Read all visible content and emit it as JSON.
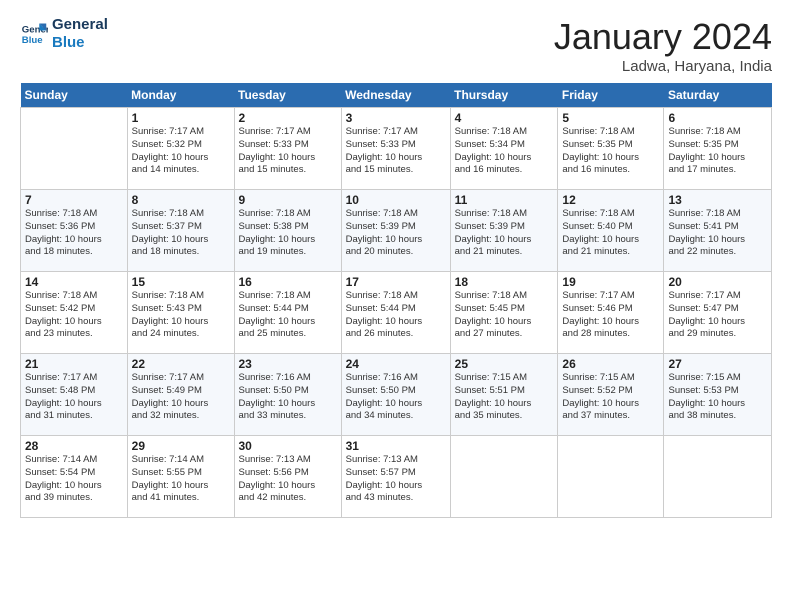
{
  "header": {
    "logo_line1": "General",
    "logo_line2": "Blue",
    "title": "January 2024",
    "location": "Ladwa, Haryana, India"
  },
  "columns": [
    "Sunday",
    "Monday",
    "Tuesday",
    "Wednesday",
    "Thursday",
    "Friday",
    "Saturday"
  ],
  "weeks": [
    [
      {
        "day": "",
        "info": ""
      },
      {
        "day": "1",
        "info": "Sunrise: 7:17 AM\nSunset: 5:32 PM\nDaylight: 10 hours\nand 14 minutes."
      },
      {
        "day": "2",
        "info": "Sunrise: 7:17 AM\nSunset: 5:33 PM\nDaylight: 10 hours\nand 15 minutes."
      },
      {
        "day": "3",
        "info": "Sunrise: 7:17 AM\nSunset: 5:33 PM\nDaylight: 10 hours\nand 15 minutes."
      },
      {
        "day": "4",
        "info": "Sunrise: 7:18 AM\nSunset: 5:34 PM\nDaylight: 10 hours\nand 16 minutes."
      },
      {
        "day": "5",
        "info": "Sunrise: 7:18 AM\nSunset: 5:35 PM\nDaylight: 10 hours\nand 16 minutes."
      },
      {
        "day": "6",
        "info": "Sunrise: 7:18 AM\nSunset: 5:35 PM\nDaylight: 10 hours\nand 17 minutes."
      }
    ],
    [
      {
        "day": "7",
        "info": "Sunrise: 7:18 AM\nSunset: 5:36 PM\nDaylight: 10 hours\nand 18 minutes."
      },
      {
        "day": "8",
        "info": "Sunrise: 7:18 AM\nSunset: 5:37 PM\nDaylight: 10 hours\nand 18 minutes."
      },
      {
        "day": "9",
        "info": "Sunrise: 7:18 AM\nSunset: 5:38 PM\nDaylight: 10 hours\nand 19 minutes."
      },
      {
        "day": "10",
        "info": "Sunrise: 7:18 AM\nSunset: 5:39 PM\nDaylight: 10 hours\nand 20 minutes."
      },
      {
        "day": "11",
        "info": "Sunrise: 7:18 AM\nSunset: 5:39 PM\nDaylight: 10 hours\nand 21 minutes."
      },
      {
        "day": "12",
        "info": "Sunrise: 7:18 AM\nSunset: 5:40 PM\nDaylight: 10 hours\nand 21 minutes."
      },
      {
        "day": "13",
        "info": "Sunrise: 7:18 AM\nSunset: 5:41 PM\nDaylight: 10 hours\nand 22 minutes."
      }
    ],
    [
      {
        "day": "14",
        "info": "Sunrise: 7:18 AM\nSunset: 5:42 PM\nDaylight: 10 hours\nand 23 minutes."
      },
      {
        "day": "15",
        "info": "Sunrise: 7:18 AM\nSunset: 5:43 PM\nDaylight: 10 hours\nand 24 minutes."
      },
      {
        "day": "16",
        "info": "Sunrise: 7:18 AM\nSunset: 5:44 PM\nDaylight: 10 hours\nand 25 minutes."
      },
      {
        "day": "17",
        "info": "Sunrise: 7:18 AM\nSunset: 5:44 PM\nDaylight: 10 hours\nand 26 minutes."
      },
      {
        "day": "18",
        "info": "Sunrise: 7:18 AM\nSunset: 5:45 PM\nDaylight: 10 hours\nand 27 minutes."
      },
      {
        "day": "19",
        "info": "Sunrise: 7:17 AM\nSunset: 5:46 PM\nDaylight: 10 hours\nand 28 minutes."
      },
      {
        "day": "20",
        "info": "Sunrise: 7:17 AM\nSunset: 5:47 PM\nDaylight: 10 hours\nand 29 minutes."
      }
    ],
    [
      {
        "day": "21",
        "info": "Sunrise: 7:17 AM\nSunset: 5:48 PM\nDaylight: 10 hours\nand 31 minutes."
      },
      {
        "day": "22",
        "info": "Sunrise: 7:17 AM\nSunset: 5:49 PM\nDaylight: 10 hours\nand 32 minutes."
      },
      {
        "day": "23",
        "info": "Sunrise: 7:16 AM\nSunset: 5:50 PM\nDaylight: 10 hours\nand 33 minutes."
      },
      {
        "day": "24",
        "info": "Sunrise: 7:16 AM\nSunset: 5:50 PM\nDaylight: 10 hours\nand 34 minutes."
      },
      {
        "day": "25",
        "info": "Sunrise: 7:15 AM\nSunset: 5:51 PM\nDaylight: 10 hours\nand 35 minutes."
      },
      {
        "day": "26",
        "info": "Sunrise: 7:15 AM\nSunset: 5:52 PM\nDaylight: 10 hours\nand 37 minutes."
      },
      {
        "day": "27",
        "info": "Sunrise: 7:15 AM\nSunset: 5:53 PM\nDaylight: 10 hours\nand 38 minutes."
      }
    ],
    [
      {
        "day": "28",
        "info": "Sunrise: 7:14 AM\nSunset: 5:54 PM\nDaylight: 10 hours\nand 39 minutes."
      },
      {
        "day": "29",
        "info": "Sunrise: 7:14 AM\nSunset: 5:55 PM\nDaylight: 10 hours\nand 41 minutes."
      },
      {
        "day": "30",
        "info": "Sunrise: 7:13 AM\nSunset: 5:56 PM\nDaylight: 10 hours\nand 42 minutes."
      },
      {
        "day": "31",
        "info": "Sunrise: 7:13 AM\nSunset: 5:57 PM\nDaylight: 10 hours\nand 43 minutes."
      },
      {
        "day": "",
        "info": ""
      },
      {
        "day": "",
        "info": ""
      },
      {
        "day": "",
        "info": ""
      }
    ]
  ]
}
